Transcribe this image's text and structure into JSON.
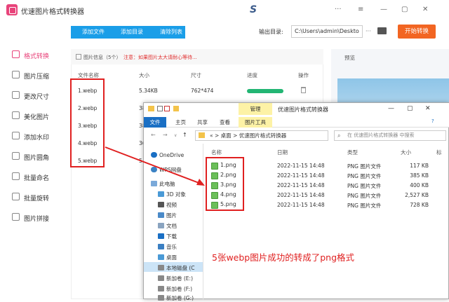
{
  "app": {
    "title": "优速图片格式转换器",
    "window_controls": [
      "—",
      "▢",
      "✕"
    ]
  },
  "toolbar": {
    "add_file": "添加文件",
    "add_folder": "添加目录",
    "clear_list": "清除列表",
    "output_label": "输出目录:",
    "output_path": "C:\\Users\\admin\\Deskto",
    "output_more": "···",
    "convert": "开始转换"
  },
  "sidebar": [
    {
      "label": "格式转换",
      "icon": "convert-icon",
      "active": true
    },
    {
      "label": "图片压缩",
      "icon": "compress-icon"
    },
    {
      "label": "更改尺寸",
      "icon": "resize-icon"
    },
    {
      "label": "美化图片",
      "icon": "beautify-icon"
    },
    {
      "label": "添加水印",
      "icon": "watermark-icon"
    },
    {
      "label": "图片圆角",
      "icon": "round-corner-icon"
    },
    {
      "label": "批量命名",
      "icon": "rename-icon"
    },
    {
      "label": "批量旋转",
      "icon": "rotate-icon"
    },
    {
      "label": "图片拼接",
      "icon": "stitch-icon"
    }
  ],
  "file_panel": {
    "info_label": "图片信息（5个）",
    "notice": "注意：如果图片太大请耐心等待...",
    "columns": [
      "文件名称",
      "大小",
      "尺寸",
      "进度",
      "操作"
    ],
    "rows": [
      {
        "name": "1.webp",
        "size": "5.34KB",
        "dims": "762*474",
        "progress": 1.0
      },
      {
        "name": "2.webp",
        "size": "38",
        "dims": "",
        "progress": null
      },
      {
        "name": "3.webp",
        "size": "38",
        "dims": "",
        "progress": null
      },
      {
        "name": "4.webp",
        "size": "36",
        "dims": "",
        "progress": null
      },
      {
        "name": "5.webp",
        "size": "5",
        "dims": "",
        "progress": null
      }
    ]
  },
  "preview": {
    "label": "预览"
  },
  "explorer": {
    "title": "优速图片格式转换器",
    "manage_tab": "管理",
    "ribbon_tabs": [
      "文件",
      "主页",
      "共享",
      "查看"
    ],
    "tools_tab": "图片工具",
    "address": [
      "«",
      "桌面",
      "优速图片格式转换器"
    ],
    "search_placeholder": "在 优速图片格式转换器 中搜索",
    "nav_items": [
      "OneDrive",
      "WPS网盘",
      "此电脑",
      "3D 对象",
      "视频",
      "图片",
      "文档",
      "下载",
      "音乐",
      "桌面",
      "本地磁盘 (C",
      "新加卷 (E:)",
      "新加卷 (F:)",
      "新加卷 (G:)"
    ],
    "columns": [
      "名称",
      "日期",
      "类型",
      "大小",
      "标"
    ],
    "files": [
      {
        "name": "1.png",
        "date": "2022-11-15 14:48",
        "type": "PNG 图片文件",
        "size": "117 KB"
      },
      {
        "name": "2.png",
        "date": "2022-11-15 14:48",
        "type": "PNG 图片文件",
        "size": "385 KB"
      },
      {
        "name": "3.png",
        "date": "2022-11-15 14:48",
        "type": "PNG 图片文件",
        "size": "400 KB"
      },
      {
        "name": "4.png",
        "date": "2022-11-15 14:48",
        "type": "PNG 图片文件",
        "size": "2,527 KB"
      },
      {
        "name": "5.png",
        "date": "2022-11-15 14:48",
        "type": "PNG 图片文件",
        "size": "728 KB"
      }
    ]
  },
  "caption": "5张webp图片成功的转成了png格式",
  "colors": {
    "accent": "#e8437a",
    "toolbar_blue": "#1a9ee8",
    "convert_orange": "#f26522",
    "highlight_red": "#e02020",
    "progress_green": "#22b573"
  }
}
